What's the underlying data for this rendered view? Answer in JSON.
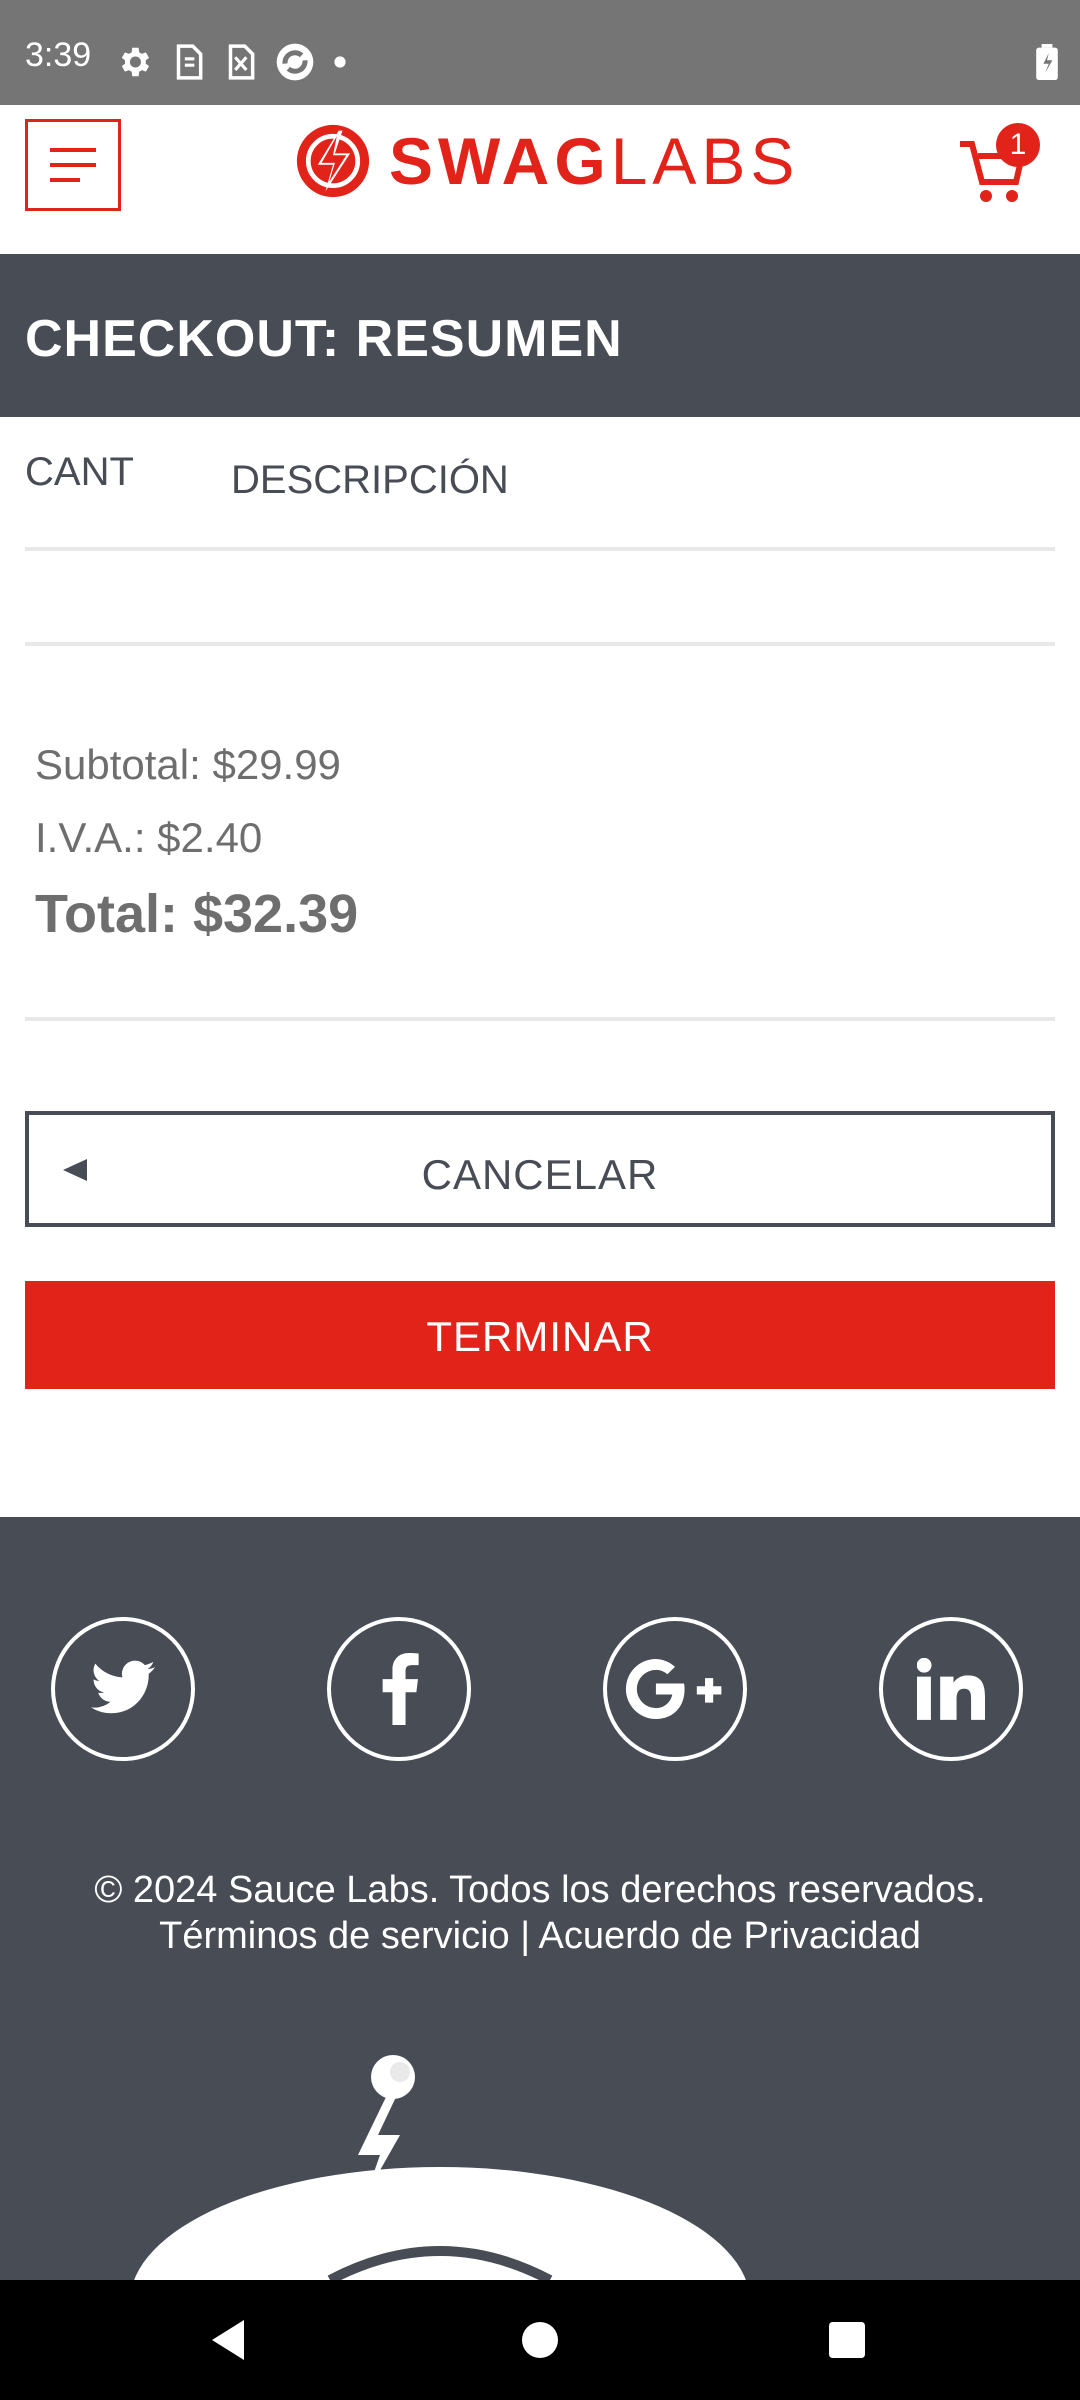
{
  "status_bar": {
    "time": "3:39",
    "icons": [
      "gear-icon",
      "sim-icon",
      "sim-off-icon",
      "sync-icon",
      "dot-icon",
      "battery-icon"
    ]
  },
  "header": {
    "logo": {
      "bold": "SWAG",
      "light": "LABS",
      "color": "#e2231a"
    },
    "menu_icon": "hamburger-menu-icon",
    "cart_icon": "cart-icon",
    "cart_count": "1"
  },
  "page": {
    "title": "CHECKOUT: RESUMEN"
  },
  "table": {
    "columns": [
      "CANT",
      "DESCRIPCIÓN"
    ]
  },
  "summary": {
    "subtotal": "Subtotal: $29.99",
    "tax": "I.V.A.: $2.40",
    "total": "Total: $32.39"
  },
  "buttons": {
    "cancel": "CANCELAR",
    "finish": "TERMINAR"
  },
  "footer": {
    "social": [
      "twitter-icon",
      "facebook-icon",
      "google-plus-icon",
      "linkedin-icon"
    ],
    "copyright": "© 2024 Sauce Labs. Todos los derechos reservados.",
    "links": "Términos de servicio | Acuerdo de Privacidad"
  },
  "nav_bar": {
    "buttons": [
      "back-icon",
      "home-icon",
      "recents-icon"
    ]
  },
  "colors": {
    "brand_red": "#e2231a",
    "dark_slate": "#474c55",
    "status_bar": "#757575"
  }
}
